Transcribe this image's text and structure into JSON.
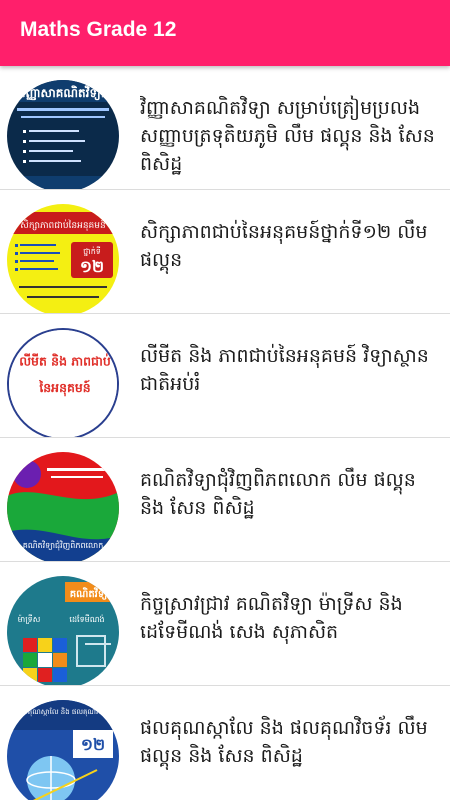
{
  "appbar": {
    "title": "Maths Grade 12"
  },
  "colors": {
    "appbar_bg": "#ff1f6b",
    "divider": "#dcdcdc"
  },
  "items": [
    {
      "title": "វិញ្ញាសាគណិតវិទ្យា សម្រាប់ត្រៀមប្រលងសញ្ញាបត្រទុតិយភូមិ លឹម ផល្គុន និង សែន ពិសិដ្ឋ",
      "thumb_title": "វិញ្ញាសាគណិតវិទ្យា"
    },
    {
      "title": "សិក្សាភាពជាប់នៃអនុគមន៍ថ្នាក់ទី១២ លឹម ផល្គុន",
      "thumb_title": "សិក្សាភាពជាប់នៃអនុគមន៍",
      "thumb_grade_label": "ថ្នាក់ទី",
      "thumb_grade": "១២"
    },
    {
      "title": "លីមីត និង ភាពជាប់នៃអនុគមន៍ វិទ្យាស្ថានជាតិអប់រំ",
      "thumb_title": "លីមីត និង ភាពជាប់",
      "thumb_subtitle": "នៃអនុគមន៍"
    },
    {
      "title": "គណិតវិទ្យាជុំវិញពិភពលោក លឹម ផល្គុន និង សែន ពិសិដ្ឋ",
      "thumb_title": "គណិតវិទ្យាជុំវិញពិភពលោក"
    },
    {
      "title": "កិច្ចស្រាវជ្រាវ គណិតវិទ្យា ម៉ាទ្រីស និង ដេទែមីណង់ សេង សុភាសិត",
      "thumb_title": "គណិតវិទ្យា",
      "thumb_left": "ម៉ាទ្រីស",
      "thumb_right": "ដេទែមីណង់"
    },
    {
      "title": "ផលគុណស្កាលែ និង ផលគុណវិចទ័រ លឹម ផល្គុន និង សែន ពិសិដ្ឋ",
      "thumb_title": "ផលគុណស្កាលែ និង ផលគុណវិចទ័រ",
      "thumb_grade": "១២"
    }
  ]
}
